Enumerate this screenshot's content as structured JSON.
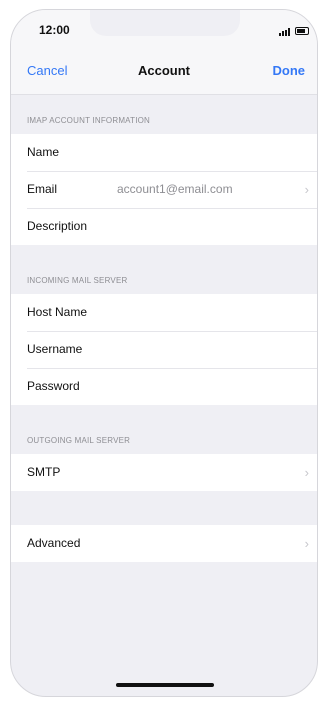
{
  "status_bar": {
    "time": "12:00"
  },
  "nav": {
    "cancel_label": "Cancel",
    "title": "Account",
    "done_label": "Done"
  },
  "sections": {
    "imap": {
      "header": "IMAP ACCOUNT INFORMATION",
      "rows": {
        "name": {
          "label": "Name"
        },
        "email": {
          "label": "Email",
          "value": "account1@email.com"
        },
        "description": {
          "label": "Description"
        }
      }
    },
    "incoming": {
      "header": "INCOMING MAIL SERVER",
      "rows": {
        "host_name": {
          "label": "Host Name"
        },
        "username": {
          "label": "Username"
        },
        "password": {
          "label": "Password"
        }
      }
    },
    "outgoing": {
      "header": "OUTGOING MAIL SERVER",
      "rows": {
        "smtp": {
          "label": "SMTP"
        }
      }
    },
    "advanced": {
      "rows": {
        "advanced": {
          "label": "Advanced"
        }
      }
    }
  },
  "icons": {
    "chevron": "›"
  },
  "colors": {
    "accent": "#3478f6",
    "background": "#efeff4",
    "secondary_text": "#8e8e93"
  }
}
